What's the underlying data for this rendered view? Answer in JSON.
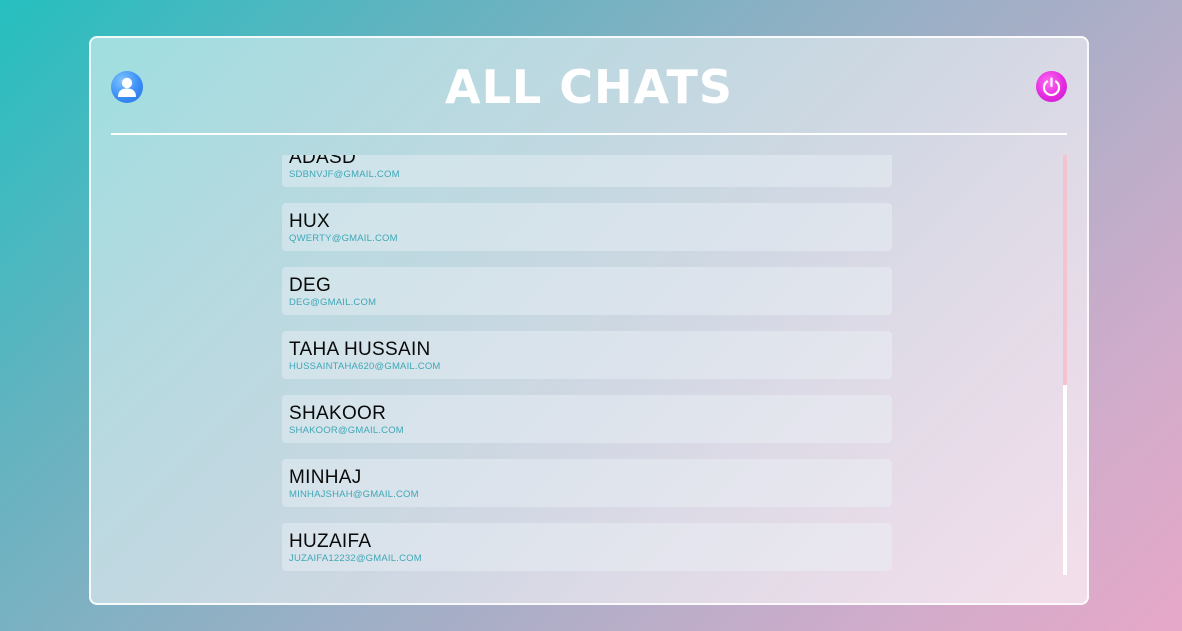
{
  "header": {
    "title": "ALL CHATS",
    "profile_icon": "user-icon",
    "logout_icon": "power-icon"
  },
  "chats": [
    {
      "name": "ADASD",
      "email": "SDBNVJF@GMAIL.COM"
    },
    {
      "name": "HUX",
      "email": "QWERTY@GMAIL.COM"
    },
    {
      "name": "DEG",
      "email": "DEG@GMAIL.COM"
    },
    {
      "name": "TAHA HUSSAIN",
      "email": "HUSSAINTAHA620@GMAIL.COM"
    },
    {
      "name": "SHAKOOR",
      "email": "SHAKOOR@GMAIL.COM"
    },
    {
      "name": "MINHAJ",
      "email": "MINHAJSHAH@GMAIL.COM"
    },
    {
      "name": "HUZAIFA",
      "email": "JUZAIFA12232@GMAIL.COM"
    }
  ],
  "colors": {
    "profile_accent": "#3a8ef6",
    "logout_accent": "#e42ae0",
    "email_text": "#3fa7b7",
    "scroll_thumb": "#f4c3cf"
  }
}
